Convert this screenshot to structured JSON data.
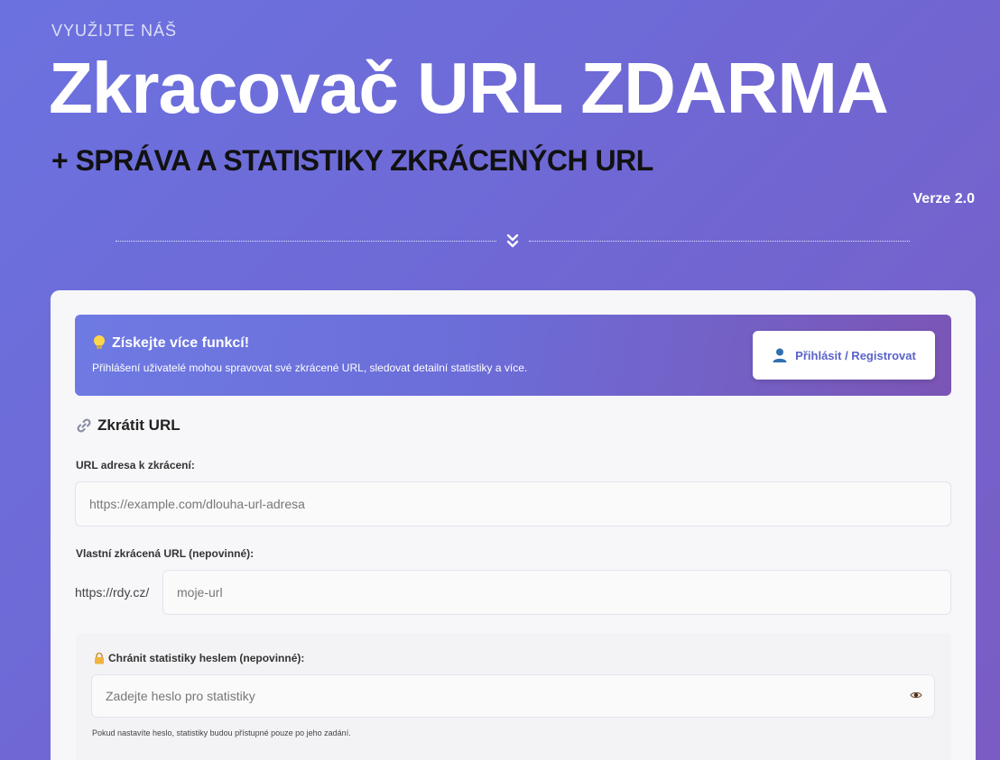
{
  "hero": {
    "eyebrow": "VYUŽIJTE NÁŠ",
    "title": "Zkracovač URL ZDARMA",
    "subtitle": "+ SPRÁVA A STATISTIKY ZKRÁCENÝCH URL",
    "version": "Verze 2.0",
    "divider_icon": "chevron-double-down-icon"
  },
  "promo": {
    "icon": "lightbulb-icon",
    "title": "Získejte více funkcí!",
    "description": "Přihlášení uživatelé mohou spravovat své zkrácené URL, sledovat detailní statistiky a více.",
    "button_icon": "user-icon",
    "button_label": "Přihlásit / Registrovat"
  },
  "form": {
    "section_icon": "link-icon",
    "section_title": "Zkrátit URL",
    "url_label": "URL adresa k zkrácení:",
    "url_placeholder": "https://example.com/dlouha-url-adresa",
    "url_value": "",
    "custom_label": "Vlastní zkrácená URL (nepovinné):",
    "custom_prefix": "https://rdy.cz/",
    "custom_placeholder": "moje-url",
    "custom_value": "",
    "password": {
      "icon": "lock-icon",
      "label": "Chránit statistiky heslem (nepovinné):",
      "placeholder": "Zadejte heslo pro statistiky",
      "value": "",
      "toggle_icon": "eye-icon",
      "hint": "Pokud nastavíte heslo, statistiky budou přístupné pouze po jeho zadání."
    }
  },
  "colors": {
    "background_start": "#6b72e0",
    "background_end": "#7a5cc4",
    "accent": "#5b63c9",
    "card": "#f7f7fa"
  }
}
